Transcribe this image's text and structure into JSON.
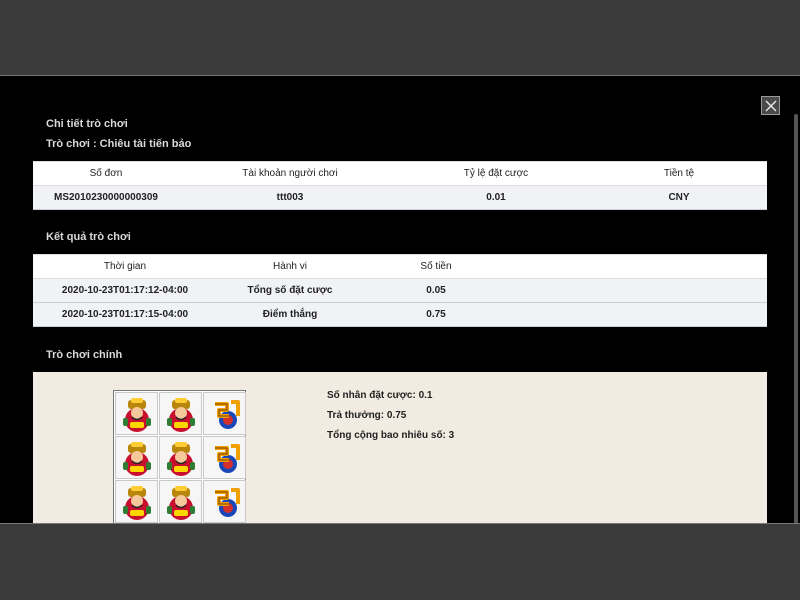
{
  "dialog": {
    "title": "Chi tiết trò chơi",
    "game_name": "Trò chơi : Chiêu tài tiến bảo"
  },
  "order_table": {
    "headers": [
      "Số đơn",
      "Tài khoản người chơi",
      "Tỷ lệ đặt cược",
      "Tiền tệ"
    ],
    "rows": [
      [
        "MS2010230000000309",
        "ttt003",
        "0.01",
        "CNY"
      ]
    ]
  },
  "result_section": {
    "title": "Kết quả trò chơi",
    "headers": [
      "Thời gian",
      "Hành vi",
      "Số tiền",
      ""
    ],
    "rows": [
      [
        "2020-10-23T01:17:12-04:00",
        "Tổng số đặt cược",
        "0.05",
        ""
      ],
      [
        "2020-10-23T01:17:15-04:00",
        "Điểm thắng",
        "0.75",
        ""
      ]
    ]
  },
  "main_game": {
    "title": "Trò chơi chính",
    "reels": [
      [
        "god-of-wealth-symbol",
        "god-of-wealth-symbol",
        "zhao-character-symbol"
      ],
      [
        "god-of-wealth-symbol",
        "god-of-wealth-symbol",
        "zhao-character-symbol"
      ],
      [
        "god-of-wealth-symbol",
        "god-of-wealth-symbol",
        "zhao-character-symbol"
      ]
    ],
    "bet_multiplier": "Số nhân đặt cược: 0.1",
    "payout": "Trả thưởng: 0.75",
    "total_count": "Tổng cộng bao nhiêu số: 3"
  },
  "colors": {
    "backdrop": "#3b3b3b",
    "modal_bg": "#000000",
    "panel_bg": "#f1ebe1",
    "row_bg": "#f0f2f5"
  }
}
